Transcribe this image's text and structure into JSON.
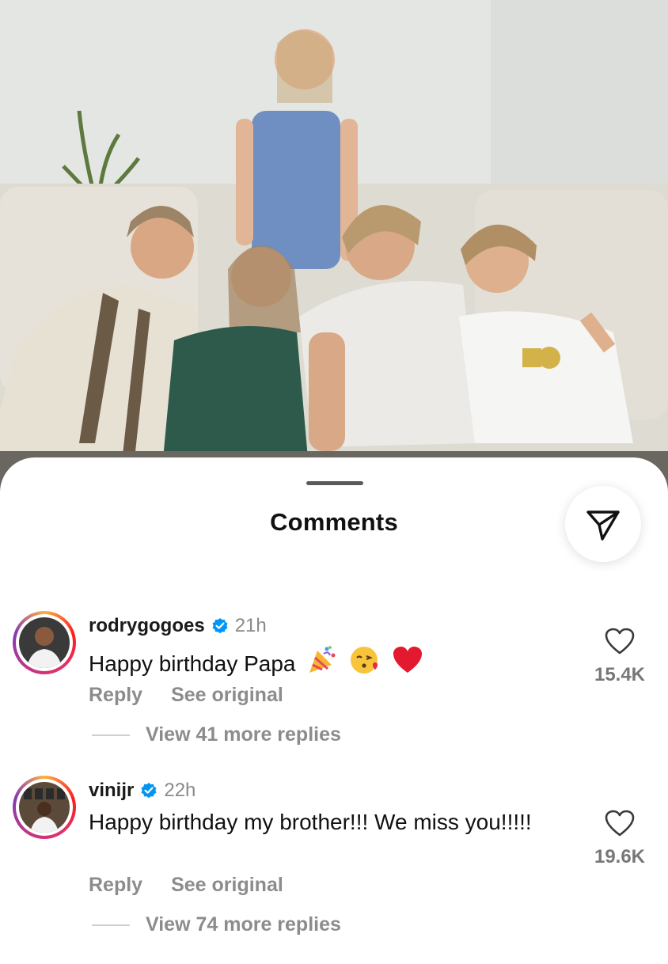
{
  "sheet": {
    "title": "Comments"
  },
  "comments": [
    {
      "username": "rodrygogoes",
      "time": "21h",
      "text": "Happy birthday Papa",
      "emojis": [
        "party-popper-emoji",
        "face-blowing-kiss-emoji",
        "red-heart-emoji"
      ],
      "likes": "15.4K",
      "reply_label": "Reply",
      "see_original_label": "See original",
      "view_replies_label": "View 41 more replies"
    },
    {
      "username": "vinijr",
      "time": "22h",
      "text": "Happy birthday my brother!!! We miss you!!!!!",
      "likes": "19.6K",
      "reply_label": "Reply",
      "see_original_label": "See original",
      "view_replies_label": "View 74 more replies"
    }
  ],
  "colors": {
    "verified_badge": "#0095f6",
    "text_primary": "#111111",
    "text_secondary": "#8c8c8c"
  }
}
